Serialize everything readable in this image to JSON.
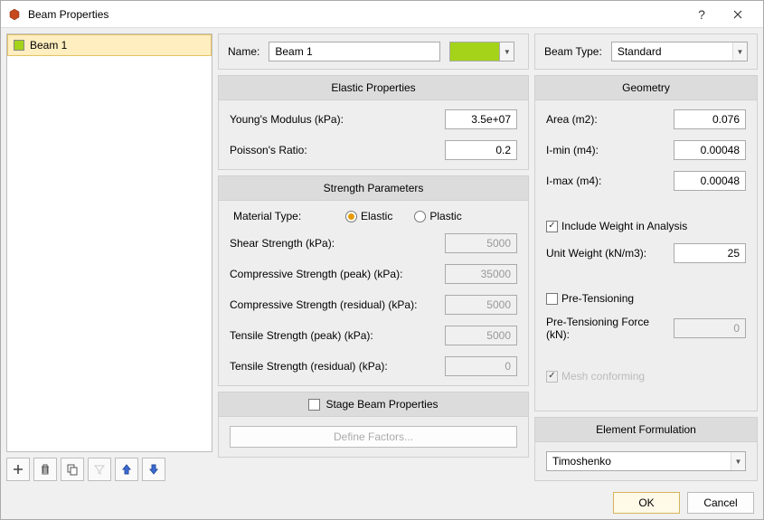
{
  "window": {
    "title": "Beam Properties"
  },
  "sidebar": {
    "items": [
      {
        "label": "Beam 1",
        "color": "#a4d31a",
        "selected": true
      }
    ]
  },
  "name_row": {
    "label": "Name:",
    "value": "Beam 1",
    "color": "#a4d31a"
  },
  "beam_type_row": {
    "label": "Beam Type:",
    "value": "Standard"
  },
  "elastic": {
    "title": "Elastic Properties",
    "young_label": "Young's Modulus (kPa):",
    "young_value": "3.5e+07",
    "poisson_label": "Poisson's Ratio:",
    "poisson_value": "0.2"
  },
  "strength": {
    "title": "Strength Parameters",
    "material_label": "Material Type:",
    "elastic_label": "Elastic",
    "plastic_label": "Plastic",
    "material_value": "Elastic",
    "shear_label": "Shear Strength (kPa):",
    "shear_value": "5000",
    "comp_peak_label": "Compressive Strength (peak) (kPa):",
    "comp_peak_value": "35000",
    "comp_res_label": "Compressive Strength (residual) (kPa):",
    "comp_res_value": "5000",
    "tens_peak_label": "Tensile Strength (peak) (kPa):",
    "tens_peak_value": "5000",
    "tens_res_label": "Tensile Strength (residual) (kPa):",
    "tens_res_value": "0"
  },
  "stage": {
    "title": "Stage Beam Properties",
    "checked": false,
    "define_label": "Define Factors..."
  },
  "geometry": {
    "title": "Geometry",
    "area_label": "Area (m2):",
    "area_value": "0.076",
    "imin_label": "I-min (m4):",
    "imin_value": "0.00048",
    "imax_label": "I-max (m4):",
    "imax_value": "0.00048",
    "include_weight_label": "Include Weight in Analysis",
    "include_weight_checked": true,
    "unit_weight_label": "Unit Weight (kN/m3):",
    "unit_weight_value": "25",
    "pretension_label": "Pre-Tensioning",
    "pretension_checked": false,
    "pretension_force_label": "Pre-Tensioning Force (kN):",
    "pretension_force_value": "0",
    "mesh_label": "Mesh conforming",
    "mesh_checked": true
  },
  "formulation": {
    "title": "Element Formulation",
    "value": "Timoshenko"
  },
  "buttons": {
    "ok": "OK",
    "cancel": "Cancel"
  }
}
